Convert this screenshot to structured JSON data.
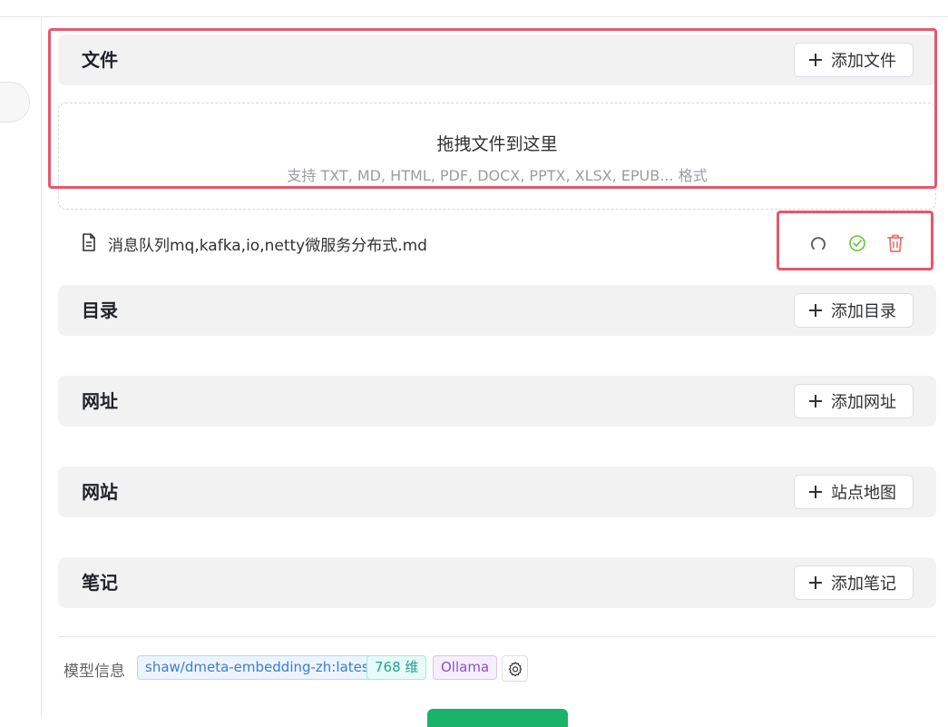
{
  "sections": {
    "file": {
      "title": "文件",
      "button": "添加文件"
    },
    "directory": {
      "title": "目录",
      "button": "添加目录"
    },
    "url": {
      "title": "网址",
      "button": "添加网址"
    },
    "website": {
      "title": "网站",
      "button": "站点地图"
    },
    "note": {
      "title": "笔记",
      "button": "添加笔记"
    }
  },
  "dropzone": {
    "title": "拖拽文件到这里",
    "subtitle": "支持 TXT, MD, HTML, PDF, DOCX, PPTX, XLSX, EPUB... 格式"
  },
  "files": [
    {
      "name": "消息队列mq,kafka,io,netty微服务分布式.md",
      "status": "success"
    }
  ],
  "model_info": {
    "label": "模型信息",
    "model": "shaw/dmeta-embedding-zh:latest",
    "dimensions": "768 维",
    "provider": "Ollama"
  },
  "icons": {
    "file": "file-text-icon",
    "reload": "reload-icon",
    "status": "check-circle-icon",
    "delete": "trash-icon",
    "settings": "gear-icon",
    "add": "plus-icon"
  },
  "colors": {
    "highlight": "#e8566b",
    "success": "#67c23a",
    "danger": "#f56c6c",
    "primary_button": "#19b46a"
  }
}
